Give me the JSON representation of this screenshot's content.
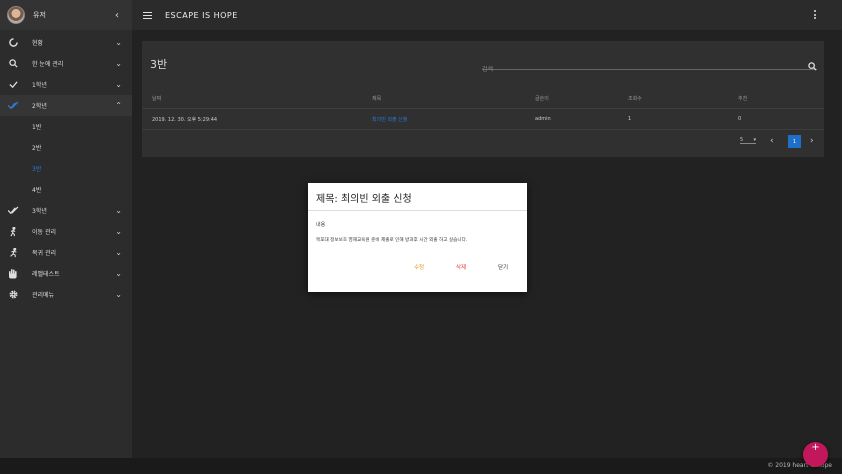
{
  "app": {
    "title": "ESCAPE IS HOPE"
  },
  "user": {
    "name": "유저"
  },
  "sidebar": {
    "items": [
      {
        "label": "현황",
        "icon": "circle-icon"
      },
      {
        "label": "한 눈에 관리",
        "icon": "search-icon"
      },
      {
        "label": "1학년",
        "icon": "check-icon"
      },
      {
        "label": "2학년",
        "icon": "check-icon",
        "expanded": true,
        "children": [
          "1반",
          "2반",
          "3반",
          "4반"
        ],
        "active_child": "3반"
      },
      {
        "label": "3학년",
        "icon": "double-check-icon"
      },
      {
        "label": "이동 관리",
        "icon": "walk-icon"
      },
      {
        "label": "복귀 관리",
        "icon": "run-icon"
      },
      {
        "label": "레벨테스트",
        "icon": "hand-icon"
      },
      {
        "label": "관리메뉴",
        "icon": "gear-icon"
      }
    ]
  },
  "card": {
    "title": "3반",
    "search_placeholder": "검색",
    "columns": [
      "날짜",
      "제목",
      "글쓴이",
      "조회수",
      "추천"
    ],
    "rows": [
      [
        "2019. 12. 30. 오후 5:29:44",
        "최의빈 외출 신청",
        "admin",
        "1",
        "0"
      ]
    ],
    "pagination": {
      "per_page": "5",
      "current_page": "1"
    }
  },
  "modal": {
    "title": "제목: 최의빈 외출 신청",
    "content_label": "내용",
    "body": "목포대 정보보호 영재교육원 준비 제출로 인해 방과후 시간 외출 하고 싶습니다.",
    "edit_label": "수정",
    "delete_label": "삭제",
    "close_label": "닫기"
  },
  "footer": {
    "copyright": "© 2019 heart is hope"
  },
  "fab": {
    "label": "+"
  },
  "colors": {
    "accent": "#2e7bd3",
    "edit": "#f08c00",
    "delete": "#e53935",
    "fab": "#c2185b"
  }
}
